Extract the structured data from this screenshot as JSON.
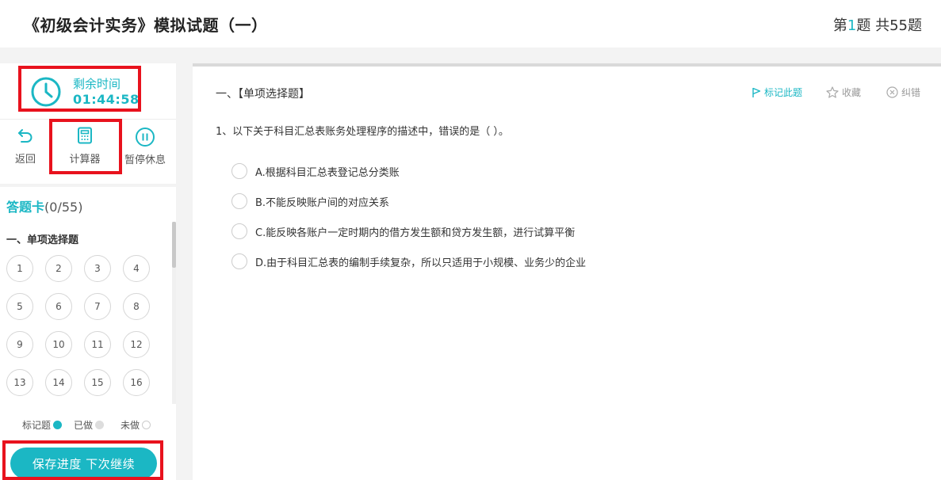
{
  "header": {
    "exam_title": "《初级会计实务》模拟试题（一）",
    "progress_prefix": "第",
    "progress_current": "1",
    "progress_suffix": "题 共55题"
  },
  "timer": {
    "label": "剩余时间",
    "value": "01:44:58"
  },
  "tools": {
    "back_label": "返回",
    "calculator_label": "计算器",
    "pause_label": "暂停休息"
  },
  "answer_card": {
    "title": "答题卡",
    "count": "(0/55)",
    "section_title": "一、单项选择题",
    "numbers": [
      "1",
      "2",
      "3",
      "4",
      "5",
      "6",
      "7",
      "8",
      "9",
      "10",
      "11",
      "12",
      "13",
      "14",
      "15",
      "16"
    ]
  },
  "legend": {
    "marked": "标记题",
    "done": "已做",
    "undone": "未做",
    "marked_color": "#1bb7c4",
    "done_color": "#dddddd",
    "undone_color": "#ffffff"
  },
  "save_button": "保存进度 下次继续",
  "question_area": {
    "type_label": "一、【单项选择题】",
    "actions": {
      "mark": "标记此题",
      "favorite": "收藏",
      "report": "纠错"
    },
    "question_text": "1、以下关于科目汇总表账务处理程序的描述中，错误的是（    ）。",
    "options": [
      "A.根据科目汇总表登记总分类账",
      "B.不能反映账户间的对应关系",
      "C.能反映各账户一定时期内的借方发生额和贷方发生额，进行试算平衡",
      "D.由于科目汇总表的编制手续复杂，所以只适用于小规模、业务少的企业"
    ]
  },
  "colors": {
    "accent": "#1bb7c4",
    "highlight_border": "#e8121d"
  }
}
